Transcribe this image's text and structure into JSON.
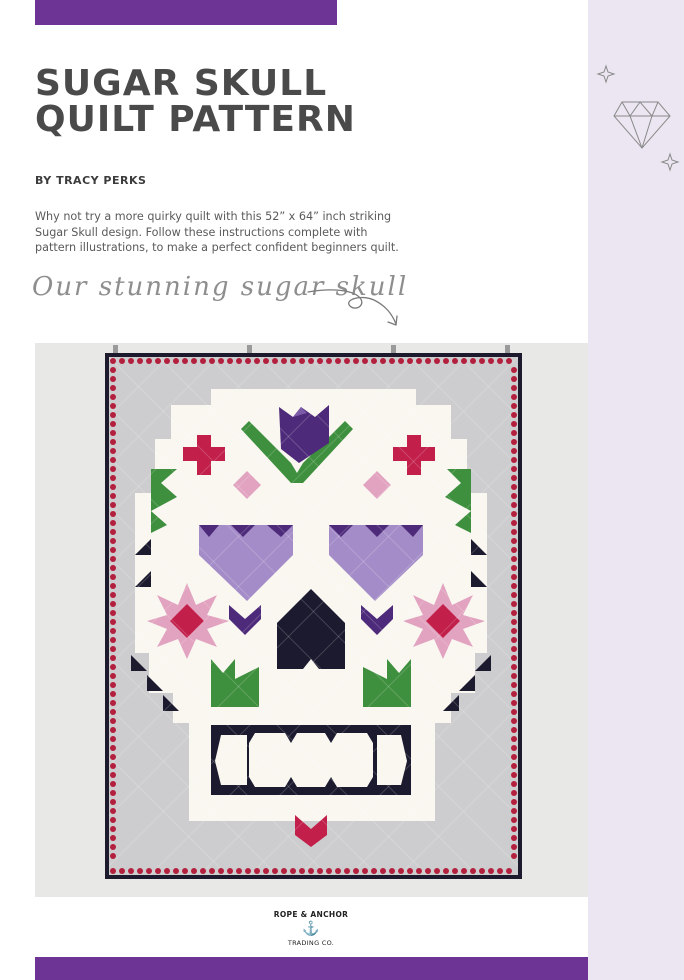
{
  "colors": {
    "accent_purple": "#6d3496",
    "sidebar_lavender": "#ebe6f1",
    "title_gray": "#4a4a4a",
    "quilt_binding": "#1e1a2e",
    "pompom_red": "#b3203d",
    "skull_cream": "#faf7f1",
    "quilt_gray": "#cdcdcf",
    "tulip_purple": "#4e2b7a",
    "eye_lavender": "#a48cc8",
    "cross_red": "#c21f4b",
    "leaf_green": "#3e8f3e",
    "pink": "#e2a3c0",
    "navy": "#1c1a2e"
  },
  "header": {
    "title_line1": "SUGAR SKULL",
    "title_line2": "QUILT PATTERN",
    "byline": "BY TRACY PERKS"
  },
  "intro": {
    "line1": "Why not try a more quirky quilt with this 52” x 64” inch striking",
    "line2": "Sugar Skull design. Follow these instructions complete with",
    "line3": "pattern illustrations, to make a perfect confident beginners quilt."
  },
  "caption": "Our stunning sugar skull",
  "icons": {
    "arrow": "curly-arrow-icon",
    "diamond": "diamond-gem-icon",
    "sparkle": "sparkle-icon",
    "anchor": "anchor-icon"
  },
  "photo": {
    "subject": "sugar-skull-quilt-photo"
  },
  "footer": {
    "logo_line1": "ROPE & ANCHOR",
    "logo_anchor": "⚓",
    "logo_line2": "TRADING CO."
  }
}
